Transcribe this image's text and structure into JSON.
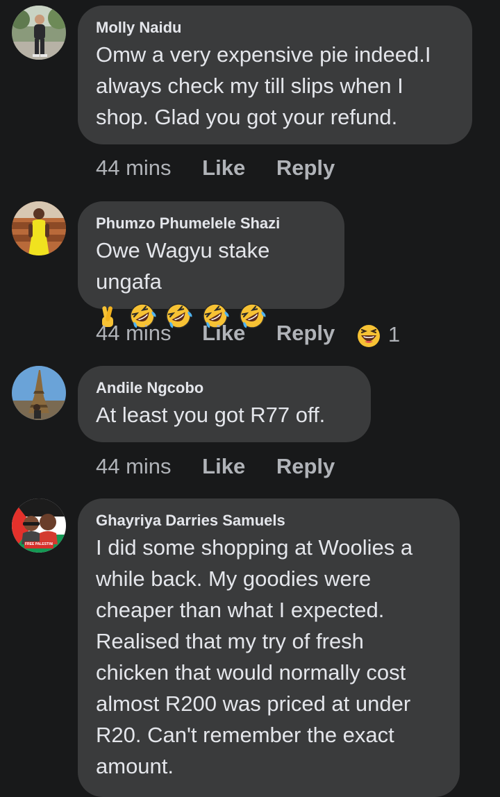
{
  "comments": [
    {
      "author": "Molly Naidu",
      "text": "Omw a very expensive pie indeed.I always check my till slips when I shop. Glad you got your refund.",
      "time": "44 mins",
      "like": "Like",
      "reply": "Reply"
    },
    {
      "author": "Phumzo Phumelele Shazi",
      "text_line1": "Owe Wagyu stake",
      "text_line2": "ungafa",
      "emojis": [
        "crossed-fingers-emoji",
        "rolling-laughing-emoji",
        "rolling-laughing-emoji",
        "rolling-laughing-emoji",
        "rolling-laughing-emoji"
      ],
      "time": "44 mins",
      "like": "Like",
      "reply": "Reply",
      "reaction_icon": "laughing-reaction-icon",
      "reaction_count": "1"
    },
    {
      "author": "Andile Ngcobo",
      "text": "At least you got R77 off.",
      "time": "44 mins",
      "like": "Like",
      "reply": "Reply"
    },
    {
      "author": "Ghayriya Darries Samuels",
      "text": "I did some shopping at Woolies a while back. My goodies were cheaper than what I expected. Realised that my try of fresh chicken that would normally cost almost R200 was priced at under R20. Can't remember the exact amount.",
      "avatar_badge": "FREE PALESTINE"
    }
  ],
  "colors": {
    "background": "#18191a",
    "bubble": "#3a3b3c",
    "text": "#e4e6eb",
    "secondary_text": "#b0b3b8",
    "emoji_yellow": "#f7c234"
  }
}
